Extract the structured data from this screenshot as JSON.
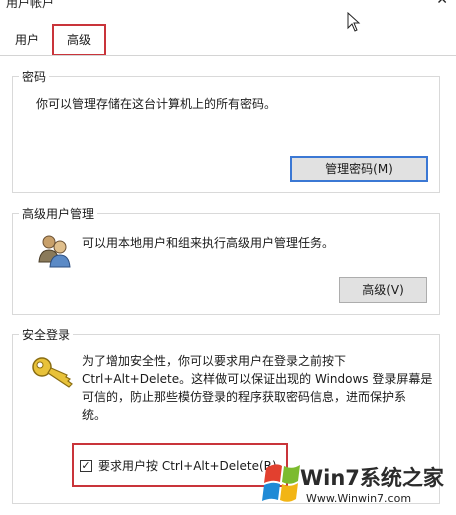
{
  "window": {
    "title": "用户帐户"
  },
  "tabs": [
    {
      "label": "用户"
    },
    {
      "label": "高级"
    }
  ],
  "passwords": {
    "title": "密码",
    "description": "你可以管理存储在这台计算机上的所有密码。",
    "button": "管理密码(M)"
  },
  "user_management": {
    "title": "高级用户管理",
    "description": "可以用本地用户和组来执行高级用户管理任务。",
    "button": "高级(V)"
  },
  "secure_logon": {
    "title": "安全登录",
    "lines": [
      "为了增加安全性，你可以要求用户在登录之前按下",
      "Ctrl+Alt+Delete。这样做可以保证出现的 Windows 登录屏幕是",
      "可信的，防止那些模仿登录的程序获取密码信息，进而保护系",
      "统。"
    ],
    "checkbox_label": "要求用户按 Ctrl+Alt+Delete(R)",
    "checkbox_checked": true
  },
  "watermark": {
    "brand": "Win7系统之家",
    "url": "Www.Winwin7.com"
  },
  "colors": {
    "highlight_frame": "#c9343a",
    "focus_border": "#3b78d4"
  },
  "icons": [
    "users-icon",
    "key-icon",
    "close-icon",
    "cursor-icon",
    "windows-logo-icon"
  ]
}
